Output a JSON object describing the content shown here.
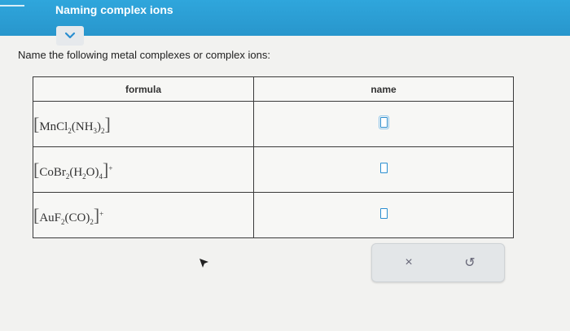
{
  "header": {
    "title": "Naming complex ions"
  },
  "prompt": "Name the following metal complexes or complex ions:",
  "table": {
    "headers": [
      "formula",
      "name"
    ],
    "rows": [
      {
        "formula_parts": [
          "Mn",
          "Cl",
          "2",
          "(N",
          "H",
          "3",
          ")",
          "2"
        ],
        "name": ""
      },
      {
        "formula_parts": [
          "Co",
          "Br",
          "2",
          "(H",
          "2",
          "O)",
          "4",
          "+"
        ],
        "name": ""
      },
      {
        "formula_parts": [
          "Au",
          "F",
          "2",
          "(CO)",
          "2",
          "+"
        ],
        "name": ""
      }
    ]
  },
  "actions": {
    "clear_symbol": "×",
    "undo_symbol": "↺"
  },
  "colors": {
    "header_bar": "#2a9fd6",
    "input_border": "#2a8ed0"
  }
}
